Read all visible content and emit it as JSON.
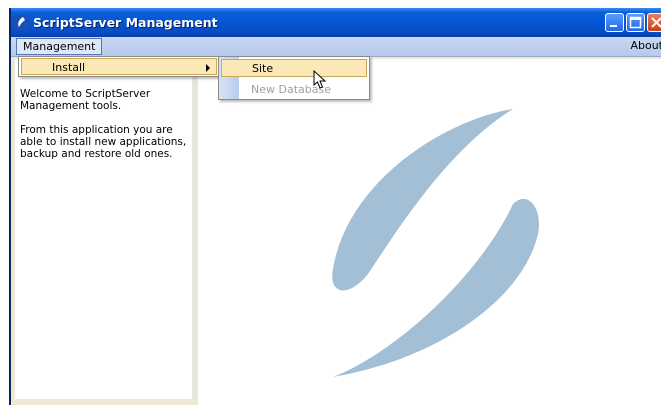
{
  "window": {
    "title": "ScriptServer Management",
    "controls": [
      "minimize-icon",
      "maximize-icon",
      "close-icon"
    ]
  },
  "menubar": {
    "management_label": "Management",
    "about_label": "About"
  },
  "management_menu": {
    "install_label": "Install"
  },
  "install_submenu": {
    "site_label": "Site",
    "new_database_label": "New Database"
  },
  "left_panel": {
    "welcome_line1": "Welcome to ScriptServer Management tools.",
    "welcome_line2": "From this application you are able to install new applications, backup and restore old ones."
  },
  "colors": {
    "titlebar": "#0454d1",
    "menu_highlight": "#fce8b6",
    "logo": "#a3bfd5"
  }
}
